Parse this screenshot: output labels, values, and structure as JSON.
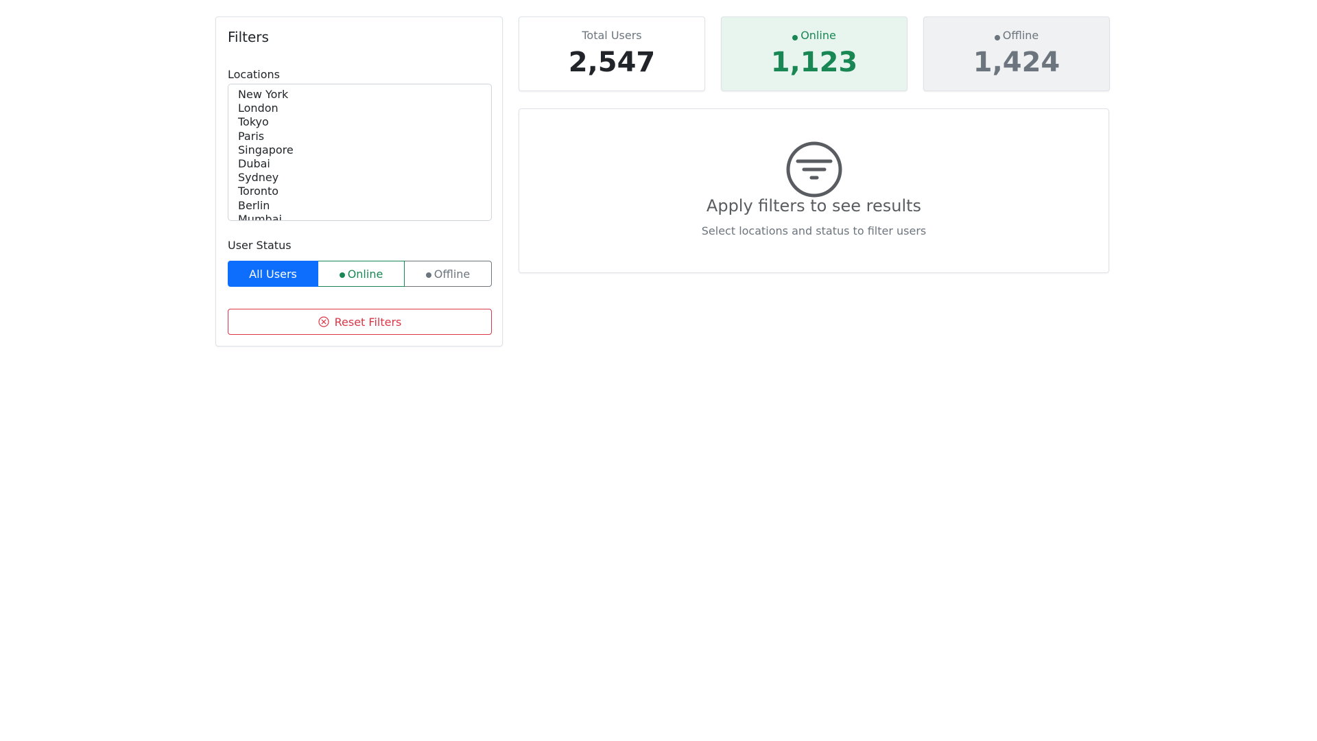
{
  "filters": {
    "title": "Filters",
    "locations_label": "Locations",
    "locations": [
      "New York",
      "London",
      "Tokyo",
      "Paris",
      "Singapore",
      "Dubai",
      "Sydney",
      "Toronto",
      "Berlin",
      "Mumbai"
    ],
    "status_label": "User Status",
    "status_options": {
      "all": "All Users",
      "online": "Online",
      "offline": "Offline"
    },
    "selected_status": "All Users",
    "reset_label": "Reset Filters"
  },
  "stats": {
    "total": {
      "label": "Total Users",
      "value": "2,547"
    },
    "online": {
      "label": "Online",
      "value": "1,123"
    },
    "offline": {
      "label": "Offline",
      "value": "1,424"
    }
  },
  "results": {
    "empty_title": "Apply filters to see results",
    "empty_subtitle": "Select locations and status to filter users",
    "icon": "filter-icon"
  },
  "colors": {
    "primary": "#0d6efd",
    "success": "#198754",
    "secondary": "#6c757d",
    "danger": "#dc3545"
  }
}
